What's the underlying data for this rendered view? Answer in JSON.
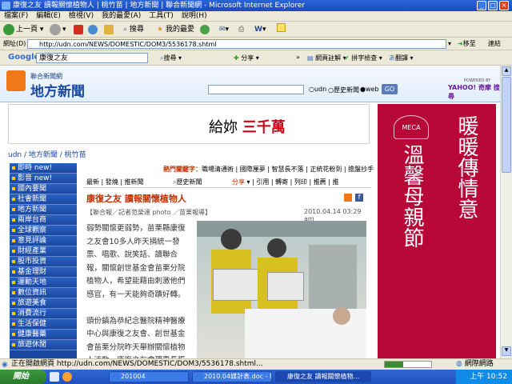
{
  "window": {
    "title": "康復之友 讀報關懷植物人 | 桃竹苗 | 地方新聞 | 聯合新聞網 - Microsoft Internet Explorer"
  },
  "menu": [
    "檔案(F)",
    "編輯(E)",
    "檢視(V)",
    "我的最愛(A)",
    "工具(T)",
    "說明(H)"
  ],
  "toolbar": {
    "back": "上一頁",
    "search": "搜尋",
    "favorites": "我的最愛"
  },
  "address": {
    "label": "網址(D)",
    "url": "http://udn.com/NEWS/DOMESTIC/DOM3/5536178.shtml",
    "go": "移至",
    "links": "連結"
  },
  "google": {
    "logo": "Google",
    "query": "康復之友",
    "search_btn": "搜尋",
    "share": "分享",
    "more": "»",
    "translate_page": "網頁註解",
    "spell": "拼字檢查",
    "translate": "翻譯"
  },
  "site": {
    "brand_small": "聯合新聞網",
    "brand_big": "地方新聞",
    "search_options": [
      "udn",
      "歷史新聞",
      "web"
    ],
    "go": "GO",
    "yahoo": "YAHOO! 奇摩 搜尋",
    "powered": "POWERED BY"
  },
  "banner": {
    "text_a": "給妳",
    "text_b": "三千萬"
  },
  "sidead": {
    "logo": "MECA",
    "col1": "暖暖傳情意",
    "col2": "溫馨母親節"
  },
  "breadcrumb": [
    "udn",
    "地方新聞",
    "桃竹苗"
  ],
  "nav": [
    "即時 new!",
    "影音 new!",
    "國內要聞",
    "社會新聞",
    "地方新聞",
    "兩岸台商",
    "全球觀察",
    "意見評論",
    "財經產業",
    "股市投資",
    "基金理財",
    "運動天地",
    "數位資訊",
    "旅遊美食",
    "消費流行",
    "生活保健",
    "健康醫藥",
    "旅遊休閒"
  ],
  "article": {
    "hotkey_label": "熱門關鍵字：",
    "hotkeys": "職場清通術 | 國際厘夢 | 智慧長不落 | 正統花粉到 | 擔盤抄手",
    "tabs": "最新 | 發燒 | 推新聞",
    "related": "歷史新聞",
    "tools": [
      "分享",
      "引用",
      "轉寄",
      "列印",
      "推薦",
      "推"
    ],
    "title": "康復之友 讀報關懷植物人",
    "meta": "【聯合報／記者范榮達 photo ／苗栗報導】",
    "date": "2010.04.14 03:29 am",
    "body": "弱勢關懷更弱勢，苗栗縣康復之友會10多人昨天捐統一發票、唱歌、說笑話、讀聯合報，關懷創世基金會苗栗分院植物人，希望能藉由刺激他們感官，有一天能夠奇蹟好轉。\n\n頭份鎮為恭紀念醫院精神醫療中心與康復之友會、創世基金會苗栗分院昨天舉辦關懷植物人活動，康復之友會理事長張"
  },
  "status": {
    "text": "正在開啟網頁 http://udn.com/NEWS/DOMESTIC/DOM3/5536178.shtml...",
    "zone": "網際網路"
  },
  "taskbar": {
    "start": "開始",
    "tasks": [
      "201004",
      "2010.04媒計表.doc - Mic...",
      "康復之友 讀報關懷植物..."
    ],
    "time": "上午 10:52"
  },
  "colors": {
    "accent": "#1a48a0",
    "ad_red": "#b80838",
    "title_red": "#c03000"
  }
}
